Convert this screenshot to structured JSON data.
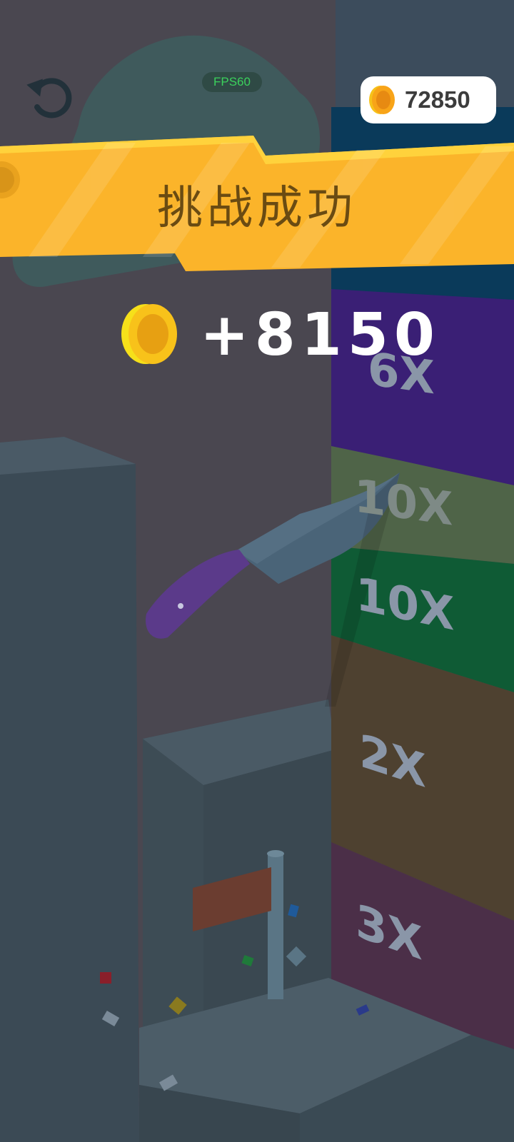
{
  "hud": {
    "fps_label": "FPS60",
    "coin_total": "72850"
  },
  "result": {
    "title": "挑战成功",
    "reward": "+8150"
  },
  "tower": {
    "multipliers": [
      "6X",
      "10X",
      "10X",
      "2X",
      "3X"
    ]
  },
  "colors": {
    "banner": "#fbb42a",
    "coin": "#f6c21a",
    "fps_text": "#3bd15c",
    "tower_purple": "#3a1f75",
    "tower_olive": "#4f6448",
    "tower_green": "#0f5b35",
    "tower_brown": "#4e4130",
    "tower_plum": "#4b2f48"
  },
  "icons": {
    "undo": "undo-icon",
    "coin": "coin-icon",
    "knife": "knife-icon"
  }
}
